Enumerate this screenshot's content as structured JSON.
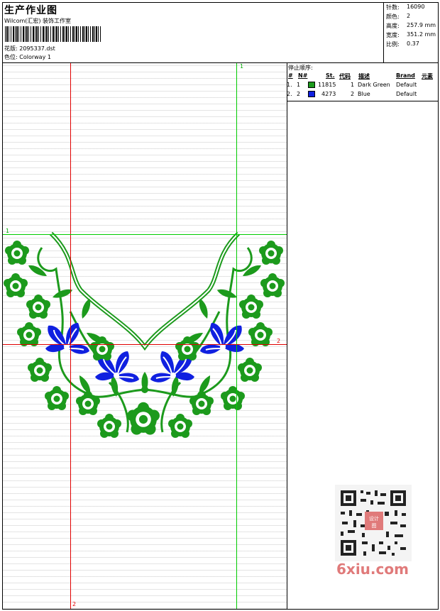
{
  "header": {
    "title": "生产作业图",
    "company": "Wilcom(汇宏) 装饰工作室",
    "design_label": "花版:",
    "design_value": "2095337.dst",
    "colorway_label": "色位:",
    "colorway_value": "Colorway 1"
  },
  "stats": [
    {
      "label": "针数:",
      "value": "16090"
    },
    {
      "label": "颜色:",
      "value": "2"
    },
    {
      "label": "高度:",
      "value": "257.9 mm"
    },
    {
      "label": "宽度:",
      "value": "351.2 mm"
    },
    {
      "label": "比例:",
      "value": "0.37"
    }
  ],
  "guides": {
    "v_red_label": "2",
    "v_green_label": "1",
    "h_green_label": "1",
    "h_red_label": "2",
    "red_color": "#e00000",
    "green_color": "#00cc00"
  },
  "sequence": {
    "caption": "停止顺序:",
    "headers": {
      "idx": "#",
      "no": "N#",
      "st": "St.",
      "code": "代码",
      "desc": "描述",
      "brand": "Brand",
      "elem": "元素"
    },
    "rows": [
      {
        "idx": "1.",
        "no": "1",
        "swatch": "#1c9a1c",
        "st": "11815",
        "code": "1",
        "desc": "Dark Green",
        "brand": "Default"
      },
      {
        "idx": "2.",
        "no": "2",
        "swatch": "#1020e0",
        "st": "4273",
        "code": "2",
        "desc": "Blue",
        "brand": "Default"
      }
    ]
  },
  "embroidery_colors": {
    "green": "#1c9a1c",
    "blue": "#1020e0"
  },
  "watermark": {
    "brand": "6xiu.com",
    "stamp": "设计图"
  }
}
